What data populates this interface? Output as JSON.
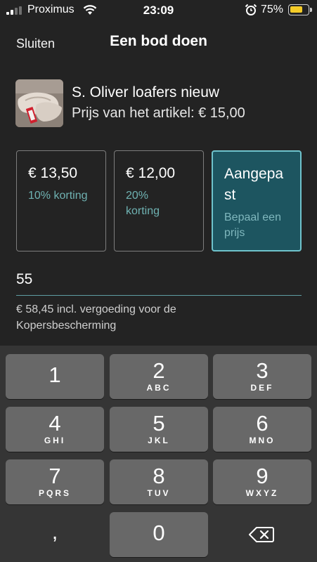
{
  "status_bar": {
    "carrier": "Proximus",
    "time": "23:09",
    "battery_percent": "75%",
    "battery_level": 0.75,
    "signal_bars": 2,
    "icons": [
      "signal-icon",
      "wifi-icon",
      "alarm-icon",
      "battery-icon"
    ]
  },
  "header": {
    "close_label": "Sluiten",
    "title": "Een bod doen"
  },
  "product": {
    "name": "S.  Oliver loafers nieuw",
    "price_line": "Prijs van het artikel: € 15,00"
  },
  "offers": [
    {
      "amount": "€ 13,50",
      "note": "10% korting",
      "selected": false
    },
    {
      "amount": "€ 12,00",
      "note": "20% korting",
      "selected": false
    },
    {
      "amount": "Aangepast",
      "note": "Bepaal een prijs",
      "selected": true
    }
  ],
  "offer_input": {
    "value": "55",
    "fee_note": "€ 58,45 incl. vergoeding voor de Kopersbescherming"
  },
  "keypad": {
    "keys": [
      {
        "digit": "1",
        "letters": ""
      },
      {
        "digit": "2",
        "letters": "ABC"
      },
      {
        "digit": "3",
        "letters": "DEF"
      },
      {
        "digit": "4",
        "letters": "GHI"
      },
      {
        "digit": "5",
        "letters": "JKL"
      },
      {
        "digit": "6",
        "letters": "MNO"
      },
      {
        "digit": "7",
        "letters": "PQRS"
      },
      {
        "digit": "8",
        "letters": "TUV"
      },
      {
        "digit": "9",
        "letters": "WXYZ"
      },
      {
        "digit": ",",
        "letters": ""
      },
      {
        "digit": "0",
        "letters": ""
      },
      {
        "digit": "",
        "letters": ""
      }
    ]
  },
  "colors": {
    "background": "#232323",
    "accent_teal": "#6fc3cc",
    "selected_card": "#1d5560",
    "discount_text": "#6fb2b2",
    "battery": "#f5cc28",
    "key": "#686868"
  }
}
